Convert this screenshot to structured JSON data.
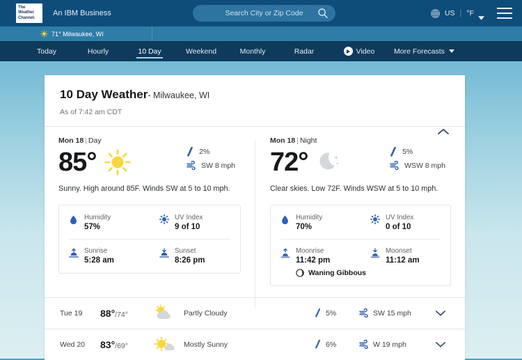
{
  "header": {
    "logo_lines": [
      "The",
      "Weather",
      "Channel."
    ],
    "tagline": "An IBM Business",
    "search_placeholder": "Search City or Zip Code",
    "search_value": "",
    "search_icon": "search-icon",
    "globe_icon": "globe-icon",
    "region": "US",
    "divider": "|",
    "units": "°F",
    "units_chevron_icon": "chevron-down-icon",
    "menu_icon": "hamburger-menu-icon"
  },
  "location_bar": {
    "icon": "sun-icon",
    "text": "71° Milwaukee, WI"
  },
  "nav": {
    "items": [
      {
        "label": "Today",
        "active": false
      },
      {
        "label": "Hourly",
        "active": false
      },
      {
        "label": "10 Day",
        "active": true
      },
      {
        "label": "Weekend",
        "active": false
      },
      {
        "label": "Monthly",
        "active": false
      },
      {
        "label": "Radar",
        "active": false
      }
    ],
    "video": {
      "label": "Video",
      "icon": "play-circle-icon"
    },
    "more": {
      "label": "More Forecasts",
      "icon": "triangle-down-icon"
    }
  },
  "page": {
    "title_main": "10 Day Weather",
    "title_location": "- Milwaukee, WI",
    "as_of": "As of 7:42 am CDT",
    "collapse_icon": "chevron-up-icon"
  },
  "detail": {
    "day": {
      "date": "Mon 18",
      "separator": "|",
      "period": "Day",
      "temp": "85°",
      "condition_icon": "sun-icon",
      "precip_icon": "raindrop-icon",
      "precip": "2%",
      "wind_icon": "wind-icon",
      "wind": "SW 8 mph",
      "narrative": "Sunny. High around 85F. Winds SW at 5 to 10 mph.",
      "stats": [
        {
          "icon": "humidity-drop-icon",
          "label": "Humidity",
          "value": "57%"
        },
        {
          "icon": "uv-sun-icon",
          "label": "UV Index",
          "value": "9 of 10"
        },
        {
          "icon": "sunrise-icon",
          "label": "Sunrise",
          "value": "5:28 am"
        },
        {
          "icon": "sunset-icon",
          "label": "Sunset",
          "value": "8:26 pm"
        }
      ]
    },
    "night": {
      "date": "Mon 18",
      "separator": "|",
      "period": "Night",
      "temp": "72°",
      "condition_icon": "moon-icon",
      "precip_icon": "raindrop-icon",
      "precip": "5%",
      "wind_icon": "wind-icon",
      "wind": "WSW 8 mph",
      "narrative": "Clear skies. Low 72F. Winds WSW at 5 to 10 mph.",
      "stats": [
        {
          "icon": "humidity-drop-icon",
          "label": "Humidity",
          "value": "70%"
        },
        {
          "icon": "uv-sun-icon",
          "label": "UV Index",
          "value": "0 of 10"
        },
        {
          "icon": "moonrise-icon",
          "label": "Moonrise",
          "value": "11:42 pm"
        },
        {
          "icon": "moonset-icon",
          "label": "Moonset",
          "value": "11:12 am"
        }
      ],
      "moon_phase_icon": "moon-phase-icon",
      "moon_phase": "Waning Gibbous"
    }
  },
  "forecast_rows": [
    {
      "day": "Tue 19",
      "high": "88°",
      "low": "/74°",
      "icon": "partly-cloudy-icon",
      "condition": "Partly Cloudy",
      "precip_icon": "raindrop-icon",
      "precip": "5%",
      "wind_icon": "wind-icon",
      "wind": "SW 15 mph",
      "expand_icon": "chevron-down-icon"
    },
    {
      "day": "Wed 20",
      "high": "83°",
      "low": "/69°",
      "icon": "mostly-sunny-icon",
      "condition": "Mostly Sunny",
      "precip_icon": "raindrop-icon",
      "precip": "6%",
      "wind_icon": "wind-icon",
      "wind": "W 19 mph",
      "expand_icon": "chevron-down-icon"
    }
  ],
  "colors": {
    "header_blue": "#0E4C7A",
    "nav_blue": "#0E3A5C",
    "location_blue": "#2F7CA8",
    "accent_blue": "#2E5FB5",
    "sun_yellow": "#F5D020",
    "text_dark": "#16181a"
  }
}
